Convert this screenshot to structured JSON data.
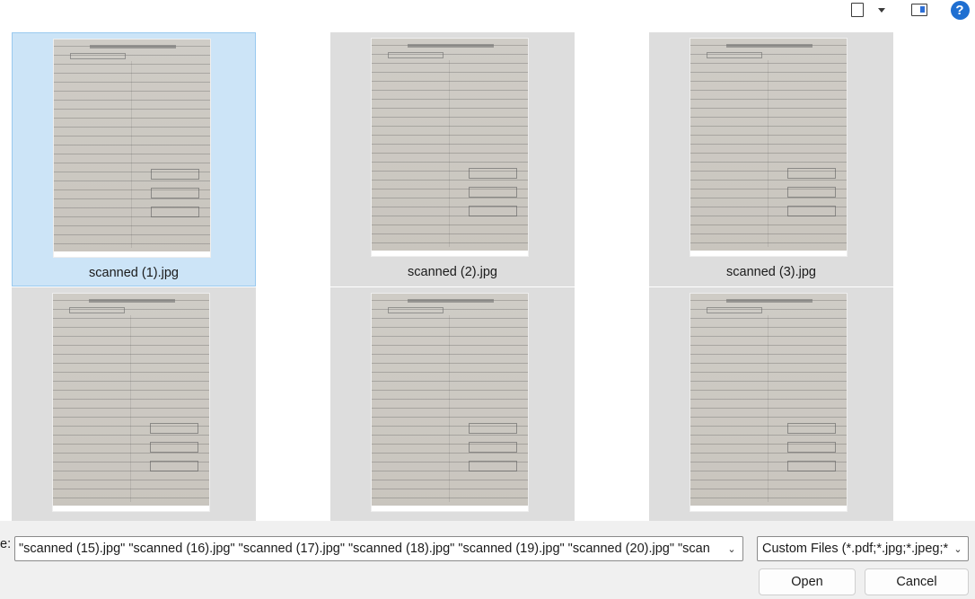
{
  "toolbar": {
    "icons": [
      "view-mode-icon",
      "chevron-down-icon",
      "preview-pane-icon",
      "help-icon"
    ],
    "help_label": "?"
  },
  "files": [
    {
      "name": "scanned (1).jpg",
      "selected": true
    },
    {
      "name": "scanned (2).jpg",
      "selected": false
    },
    {
      "name": "scanned (3).jpg",
      "selected": false
    },
    {
      "name": "",
      "selected": false
    },
    {
      "name": "",
      "selected": false
    },
    {
      "name": "",
      "selected": false
    }
  ],
  "filename": {
    "label": "e:",
    "value": "\"scanned (15).jpg\" \"scanned (16).jpg\" \"scanned (17).jpg\" \"scanned (18).jpg\" \"scanned (19).jpg\" \"scanned (20).jpg\" \"scan"
  },
  "filter": {
    "value": "Custom Files (*.pdf;*.jpg;*.jpeg;*"
  },
  "buttons": {
    "open": "Open",
    "cancel": "Cancel"
  },
  "colors": {
    "selected_tile": "#cce4f7",
    "tile": "#dddddd",
    "accent": "#1f6fd1"
  }
}
